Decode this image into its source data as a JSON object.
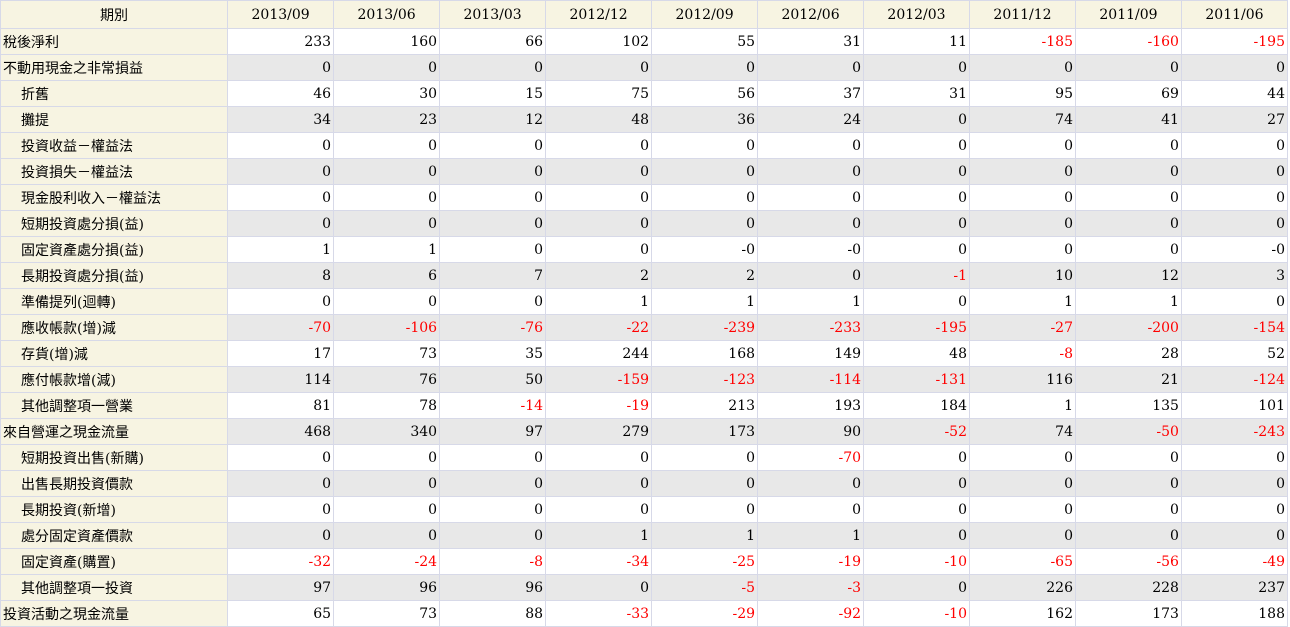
{
  "table": {
    "corner_header": "期別",
    "periods": [
      "2013/09",
      "2013/06",
      "2013/03",
      "2012/12",
      "2012/09",
      "2012/06",
      "2012/03",
      "2011/12",
      "2011/09",
      "2011/06"
    ],
    "rows": [
      {
        "label": "稅後淨利",
        "indent": false,
        "shaded": false,
        "values": [
          "233",
          "160",
          "66",
          "102",
          "55",
          "31",
          "11",
          "-185",
          "-160",
          "-195"
        ]
      },
      {
        "label": "不動用現金之非常損益",
        "indent": false,
        "shaded": true,
        "values": [
          "0",
          "0",
          "0",
          "0",
          "0",
          "0",
          "0",
          "0",
          "0",
          "0"
        ]
      },
      {
        "label": "折舊",
        "indent": true,
        "shaded": false,
        "values": [
          "46",
          "30",
          "15",
          "75",
          "56",
          "37",
          "31",
          "95",
          "69",
          "44"
        ]
      },
      {
        "label": "攤提",
        "indent": true,
        "shaded": true,
        "values": [
          "34",
          "23",
          "12",
          "48",
          "36",
          "24",
          "0",
          "74",
          "41",
          "27"
        ]
      },
      {
        "label": "投資收益－權益法",
        "indent": true,
        "shaded": false,
        "values": [
          "0",
          "0",
          "0",
          "0",
          "0",
          "0",
          "0",
          "0",
          "0",
          "0"
        ]
      },
      {
        "label": "投資損失－權益法",
        "indent": true,
        "shaded": true,
        "values": [
          "0",
          "0",
          "0",
          "0",
          "0",
          "0",
          "0",
          "0",
          "0",
          "0"
        ]
      },
      {
        "label": "現金股利收入－權益法",
        "indent": true,
        "shaded": false,
        "values": [
          "0",
          "0",
          "0",
          "0",
          "0",
          "0",
          "0",
          "0",
          "0",
          "0"
        ]
      },
      {
        "label": "短期投資處分損(益)",
        "indent": true,
        "shaded": true,
        "values": [
          "0",
          "0",
          "0",
          "0",
          "0",
          "0",
          "0",
          "0",
          "0",
          "0"
        ]
      },
      {
        "label": "固定資產處分損(益)",
        "indent": true,
        "shaded": false,
        "values": [
          "1",
          "1",
          "0",
          "0",
          "-0",
          "-0",
          "0",
          "0",
          "0",
          "-0"
        ]
      },
      {
        "label": "長期投資處分損(益)",
        "indent": true,
        "shaded": true,
        "values": [
          "8",
          "6",
          "7",
          "2",
          "2",
          "0",
          "-1",
          "10",
          "12",
          "3"
        ]
      },
      {
        "label": "準備提列(迴轉)",
        "indent": true,
        "shaded": false,
        "values": [
          "0",
          "0",
          "0",
          "1",
          "1",
          "1",
          "0",
          "1",
          "1",
          "0"
        ]
      },
      {
        "label": "應收帳款(增)減",
        "indent": true,
        "shaded": true,
        "values": [
          "-70",
          "-106",
          "-76",
          "-22",
          "-239",
          "-233",
          "-195",
          "-27",
          "-200",
          "-154"
        ]
      },
      {
        "label": "存貨(增)減",
        "indent": true,
        "shaded": false,
        "values": [
          "17",
          "73",
          "35",
          "244",
          "168",
          "149",
          "48",
          "-8",
          "28",
          "52"
        ]
      },
      {
        "label": "應付帳款增(減)",
        "indent": true,
        "shaded": true,
        "values": [
          "114",
          "76",
          "50",
          "-159",
          "-123",
          "-114",
          "-131",
          "116",
          "21",
          "-124"
        ]
      },
      {
        "label": "其他調整項一營業",
        "indent": true,
        "shaded": false,
        "values": [
          "81",
          "78",
          "-14",
          "-19",
          "213",
          "193",
          "184",
          "1",
          "135",
          "101"
        ]
      },
      {
        "label": "來自營運之現金流量",
        "indent": false,
        "shaded": true,
        "values": [
          "468",
          "340",
          "97",
          "279",
          "173",
          "90",
          "-52",
          "74",
          "-50",
          "-243"
        ]
      },
      {
        "label": "短期投資出售(新購)",
        "indent": true,
        "shaded": false,
        "values": [
          "0",
          "0",
          "0",
          "0",
          "0",
          "-70",
          "0",
          "0",
          "0",
          "0"
        ]
      },
      {
        "label": "出售長期投資價款",
        "indent": true,
        "shaded": true,
        "values": [
          "0",
          "0",
          "0",
          "0",
          "0",
          "0",
          "0",
          "0",
          "0",
          "0"
        ]
      },
      {
        "label": "長期投資(新增)",
        "indent": true,
        "shaded": false,
        "values": [
          "0",
          "0",
          "0",
          "0",
          "0",
          "0",
          "0",
          "0",
          "0",
          "0"
        ]
      },
      {
        "label": "處分固定資產價款",
        "indent": true,
        "shaded": true,
        "values": [
          "0",
          "0",
          "0",
          "1",
          "1",
          "1",
          "0",
          "0",
          "0",
          "0"
        ]
      },
      {
        "label": "固定資產(購置)",
        "indent": true,
        "shaded": false,
        "values": [
          "-32",
          "-24",
          "-8",
          "-34",
          "-25",
          "-19",
          "-10",
          "-65",
          "-56",
          "-49"
        ]
      },
      {
        "label": "其他調整項一投資",
        "indent": true,
        "shaded": true,
        "values": [
          "97",
          "96",
          "96",
          "0",
          "-5",
          "-3",
          "0",
          "226",
          "228",
          "237"
        ]
      },
      {
        "label": "投資活動之現金流量",
        "indent": false,
        "shaded": false,
        "values": [
          "65",
          "73",
          "88",
          "-33",
          "-29",
          "-92",
          "-10",
          "162",
          "173",
          "188"
        ]
      }
    ]
  },
  "colors": {
    "header_bg": "#f7f4e2",
    "shaded_row_bg": "#e8e8e8",
    "negative_text": "#ff0000",
    "grid_line": "#d7d9e8"
  }
}
